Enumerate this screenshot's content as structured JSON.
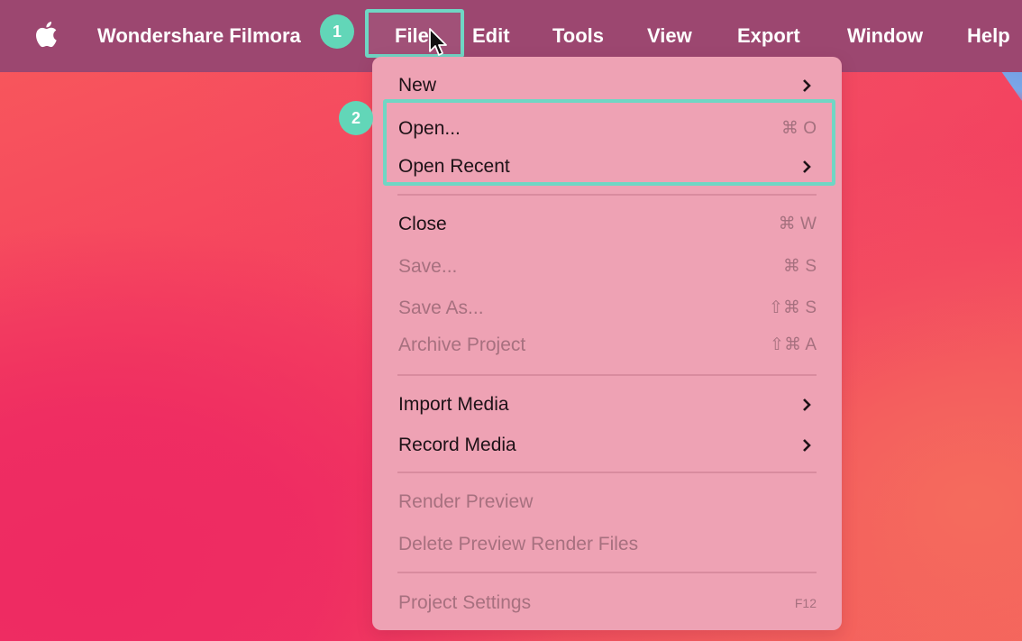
{
  "menubar": {
    "apple_icon": "apple-logo-icon",
    "app_name": "Wondershare Filmora",
    "items": [
      "File",
      "Edit",
      "Tools",
      "View",
      "Export",
      "Window",
      "Help"
    ]
  },
  "annotations": {
    "step1": "1",
    "step2": "2",
    "highlight_color": "#6fd6c4"
  },
  "file_menu": {
    "items": [
      {
        "label": "New",
        "shortcut": "",
        "submenu": true,
        "enabled": true
      },
      {
        "label": "Open...",
        "shortcut": "⌘ O",
        "submenu": false,
        "enabled": true
      },
      {
        "label": "Open Recent",
        "shortcut": "",
        "submenu": true,
        "enabled": true
      },
      {
        "label": "Close",
        "shortcut": "⌘ W",
        "submenu": false,
        "enabled": true
      },
      {
        "label": "Save...",
        "shortcut": "⌘ S",
        "submenu": false,
        "enabled": false
      },
      {
        "label": "Save As...",
        "shortcut": "⇧⌘ S",
        "submenu": false,
        "enabled": false
      },
      {
        "label": "Archive Project",
        "shortcut": "⇧⌘ A",
        "submenu": false,
        "enabled": false
      },
      {
        "label": "Import Media",
        "shortcut": "",
        "submenu": true,
        "enabled": true
      },
      {
        "label": "Record Media",
        "shortcut": "",
        "submenu": true,
        "enabled": true
      },
      {
        "label": "Render Preview",
        "shortcut": "",
        "submenu": false,
        "enabled": false
      },
      {
        "label": "Delete Preview Render Files",
        "shortcut": "",
        "submenu": false,
        "enabled": false
      },
      {
        "label": "Project Settings",
        "shortcut": "F12",
        "submenu": false,
        "enabled": false
      }
    ]
  },
  "colors": {
    "menubar": "#9c4770",
    "menu_bg": "#eea2b4",
    "badge": "#62d6b8"
  }
}
